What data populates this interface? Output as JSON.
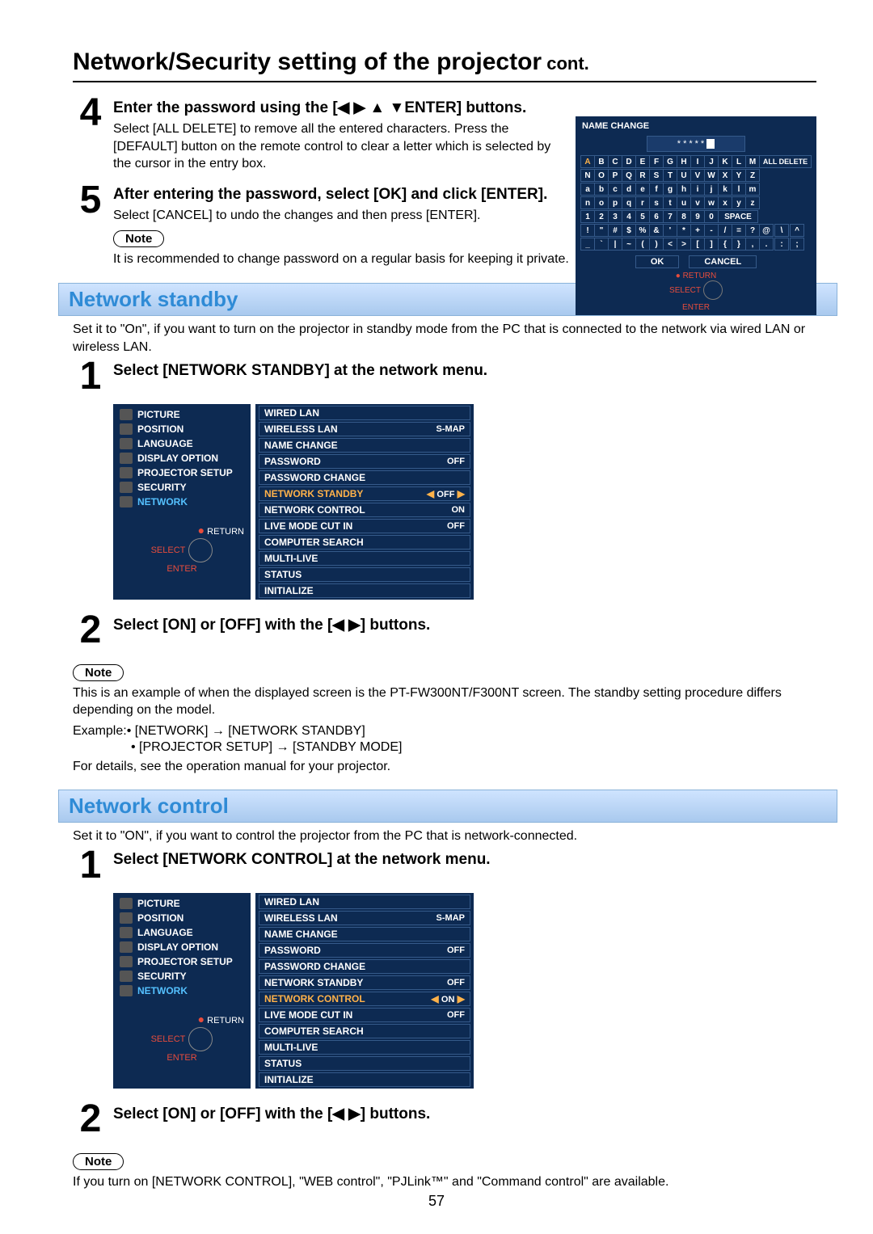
{
  "page_title": "Network/Security setting of the projector",
  "page_cont": " cont.",
  "page_number": "57",
  "step4": {
    "num": "4",
    "head": "Enter the password using the [◀ ▶ ▲ ▼ENTER] buttons.",
    "body": "Select [ALL DELETE] to remove all the entered characters. Press the [DEFAULT] button on the remote control to clear a letter which is selected by the cursor in the entry box."
  },
  "step5": {
    "num": "5",
    "head": "After entering the password, select [OK] and click [ENTER].",
    "body": "Select [CANCEL] to undo the changes and then press [ENTER].",
    "note_label": "Note",
    "note_text": "It is recommended to change password on a regular basis for keeping it private."
  },
  "kbd": {
    "title": "NAME CHANGE",
    "masked": "*****",
    "row1": [
      "A",
      "B",
      "C",
      "D",
      "E",
      "F",
      "G",
      "H",
      "I",
      "J",
      "K",
      "L",
      "M"
    ],
    "row2": [
      "N",
      "O",
      "P",
      "Q",
      "R",
      "S",
      "T",
      "U",
      "V",
      "W",
      "X",
      "Y",
      "Z"
    ],
    "row3": [
      "a",
      "b",
      "c",
      "d",
      "e",
      "f",
      "g",
      "h",
      "i",
      "j",
      "k",
      "l",
      "m"
    ],
    "row4": [
      "n",
      "o",
      "p",
      "q",
      "r",
      "s",
      "t",
      "u",
      "v",
      "w",
      "x",
      "y",
      "z"
    ],
    "row5": [
      "1",
      "2",
      "3",
      "4",
      "5",
      "6",
      "7",
      "8",
      "9",
      "0"
    ],
    "row6": [
      "!",
      "\"",
      "#",
      "$",
      "%",
      "&",
      "'",
      "*",
      "+",
      "-",
      "/",
      "=",
      "?",
      "@",
      "\\",
      "^"
    ],
    "row7": [
      "_",
      "`",
      "|",
      "~",
      "(",
      ")",
      "<",
      ">",
      "[",
      "]",
      "{",
      "}",
      ",",
      ".",
      ":",
      ";"
    ],
    "all_delete": "ALL DELETE",
    "space": "SPACE",
    "ok": "OK",
    "cancel": "CANCEL",
    "return": "RETURN",
    "select": "SELECT",
    "enter": "ENTER"
  },
  "standby": {
    "title": "Network standby",
    "intro": "Set it to \"On\", if you want to turn on the projector in standby mode from the PC that is connected to the network via wired LAN or wireless LAN.",
    "step1": {
      "num": "1",
      "head": "Select [NETWORK STANDBY] at the network menu."
    },
    "step2": {
      "num": "2",
      "head": "Select [ON] or [OFF] with the [◀ ▶] buttons."
    },
    "note_label": "Note",
    "note_text": "This is an example of when the displayed screen is the PT-FW300NT/F300NT screen. The standby setting procedure differs depending on the model.",
    "example_label": "Example:",
    "example1": "• [NETWORK] → [NETWORK STANDBY]",
    "example2": "• [PROJECTOR SETUP] → [STANDBY MODE]",
    "note_tail": "For details, see the operation manual for your projector."
  },
  "osd_left": {
    "items": [
      "PICTURE",
      "POSITION",
      "LANGUAGE",
      "DISPLAY OPTION",
      "PROJECTOR SETUP",
      "SECURITY",
      "NETWORK"
    ],
    "return": "RETURN",
    "select": "SELECT",
    "enter": "ENTER"
  },
  "osd_standby_right": [
    {
      "label": "WIRED LAN",
      "val": ""
    },
    {
      "label": "WIRELESS LAN",
      "val": "S-MAP"
    },
    {
      "label": "NAME CHANGE",
      "val": ""
    },
    {
      "label": "PASSWORD",
      "val": "OFF"
    },
    {
      "label": "PASSWORD CHANGE",
      "val": ""
    },
    {
      "label": "NETWORK STANDBY",
      "val": "OFF",
      "hi": true,
      "arrows": true
    },
    {
      "label": "NETWORK CONTROL",
      "val": "ON"
    },
    {
      "label": "LIVE MODE CUT IN",
      "val": "OFF"
    },
    {
      "label": "COMPUTER SEARCH",
      "val": ""
    },
    {
      "label": "MULTI-LIVE",
      "val": ""
    },
    {
      "label": "STATUS",
      "val": ""
    },
    {
      "label": "INITIALIZE",
      "val": ""
    }
  ],
  "control": {
    "title": "Network control",
    "intro": "Set it to \"ON\", if you want to control the projector from the PC that is network-connected.",
    "step1": {
      "num": "1",
      "head": "Select [NETWORK CONTROL] at the network menu."
    },
    "step2": {
      "num": "2",
      "head": "Select [ON] or [OFF] with the [◀ ▶] buttons."
    },
    "note_label": "Note",
    "note_text": "If you turn on [NETWORK CONTROL], \"WEB control\", \"PJLink™\" and \"Command control\" are available."
  },
  "osd_control_right": [
    {
      "label": "WIRED LAN",
      "val": ""
    },
    {
      "label": "WIRELESS LAN",
      "val": "S-MAP"
    },
    {
      "label": "NAME CHANGE",
      "val": ""
    },
    {
      "label": "PASSWORD",
      "val": "OFF"
    },
    {
      "label": "PASSWORD CHANGE",
      "val": ""
    },
    {
      "label": "NETWORK STANDBY",
      "val": "OFF"
    },
    {
      "label": "NETWORK CONTROL",
      "val": "ON",
      "hi": true,
      "arrows": true
    },
    {
      "label": "LIVE MODE CUT IN",
      "val": "OFF"
    },
    {
      "label": "COMPUTER SEARCH",
      "val": ""
    },
    {
      "label": "MULTI-LIVE",
      "val": ""
    },
    {
      "label": "STATUS",
      "val": ""
    },
    {
      "label": "INITIALIZE",
      "val": ""
    }
  ]
}
